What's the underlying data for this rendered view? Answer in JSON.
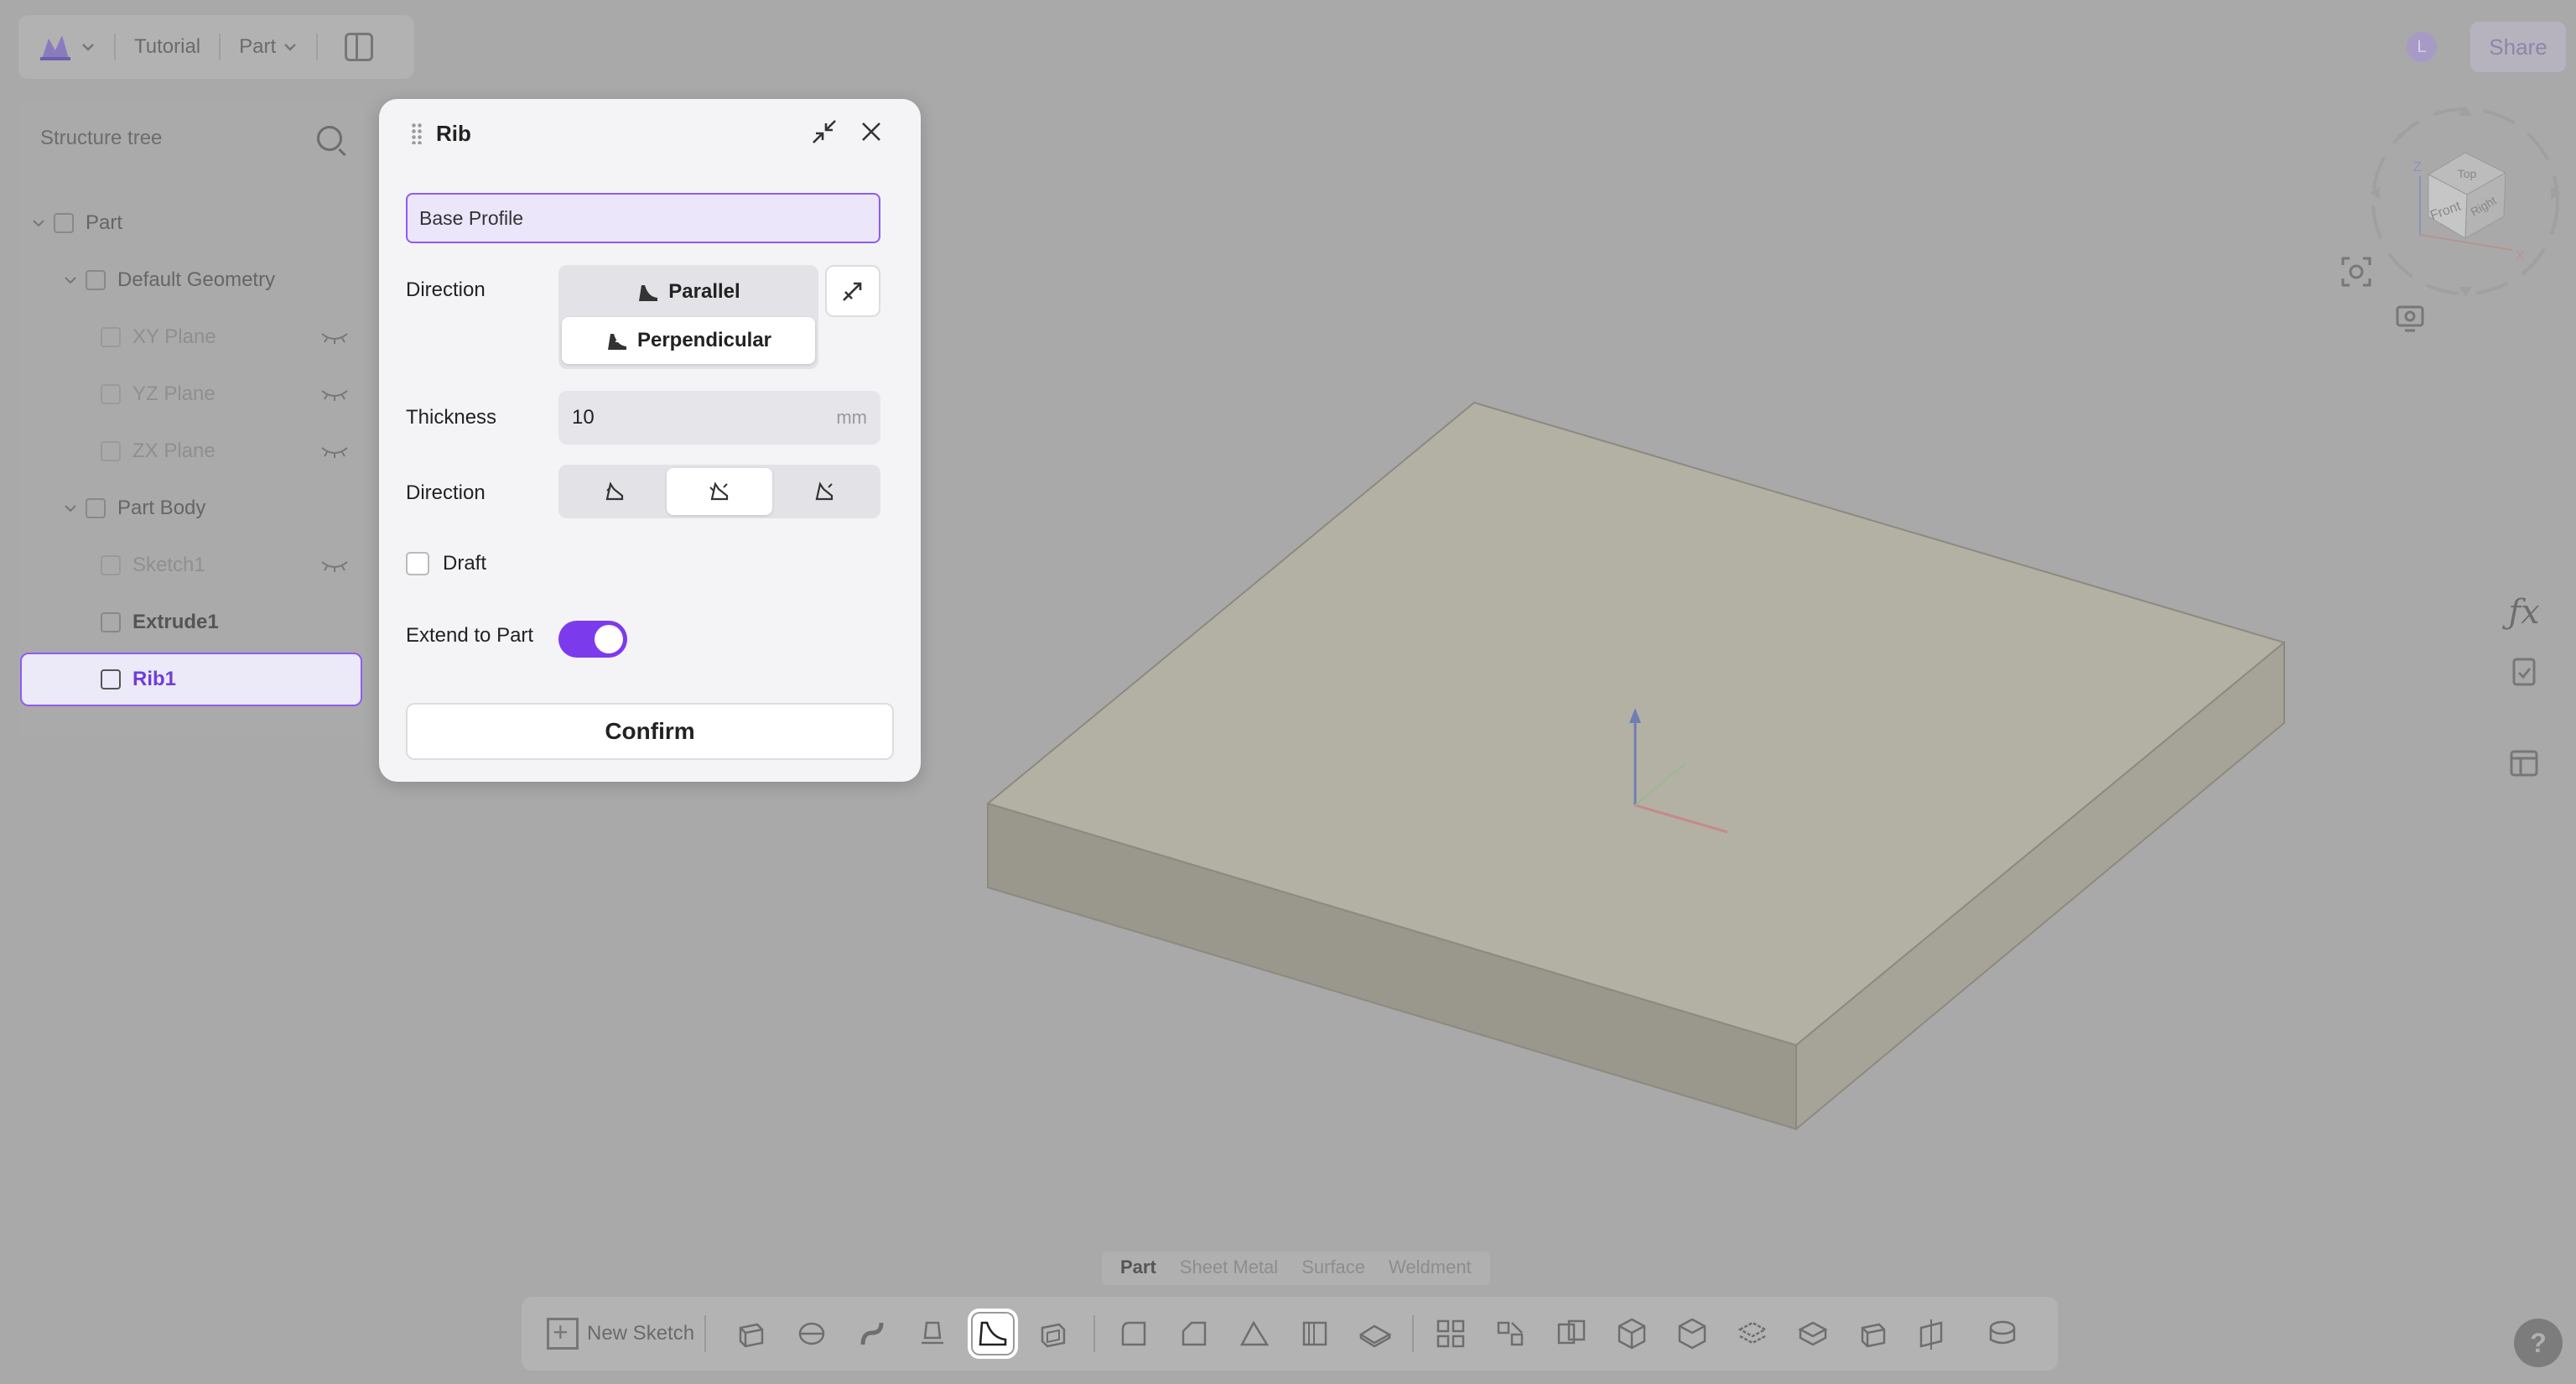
{
  "topbar": {
    "project": "Tutorial",
    "mode": "Part"
  },
  "user": {
    "avatar_letter": "L",
    "share_label": "Share"
  },
  "tree": {
    "title": "Structure tree",
    "items": [
      {
        "label": "Part"
      },
      {
        "label": "Default Geometry"
      },
      {
        "label": "XY Plane"
      },
      {
        "label": "YZ Plane"
      },
      {
        "label": "ZX Plane"
      },
      {
        "label": "Part Body"
      },
      {
        "label": "Sketch1"
      },
      {
        "label": "Extrude1"
      },
      {
        "label": "Rib1"
      }
    ]
  },
  "dialog": {
    "title": "Rib",
    "profile_value": "Base Profile",
    "direction_label": "Direction",
    "direction_options": [
      "Parallel",
      "Perpendicular"
    ],
    "direction_selected": "Perpendicular",
    "thickness_label": "Thickness",
    "thickness_value": "10",
    "thickness_unit": "mm",
    "side_label": "Direction",
    "side_selected_index": 1,
    "draft_label": "Draft",
    "draft_checked": false,
    "extend_label": "Extend to Part",
    "extend_on": true,
    "confirm_label": "Confirm"
  },
  "viewcube": {
    "faces": [
      "Top",
      "Front",
      "Right"
    ],
    "axes": [
      "Z",
      "X"
    ]
  },
  "right_tools": [
    "fx-icon",
    "clipboard-check-icon",
    "panel-icon"
  ],
  "bottom_tabs": [
    "Part",
    "Sheet Metal",
    "Surface",
    "Weldment"
  ],
  "bottom_tab_active": "Part",
  "toolbar": {
    "new_sketch_label": "New Sketch"
  },
  "help_label": "?",
  "colors": {
    "accent": "#7c3aed",
    "selection_bg": "#ece9f8",
    "overlay": "#a9a9a9",
    "model_top": "#b3b1a3",
    "model_side": "#9a988d"
  }
}
